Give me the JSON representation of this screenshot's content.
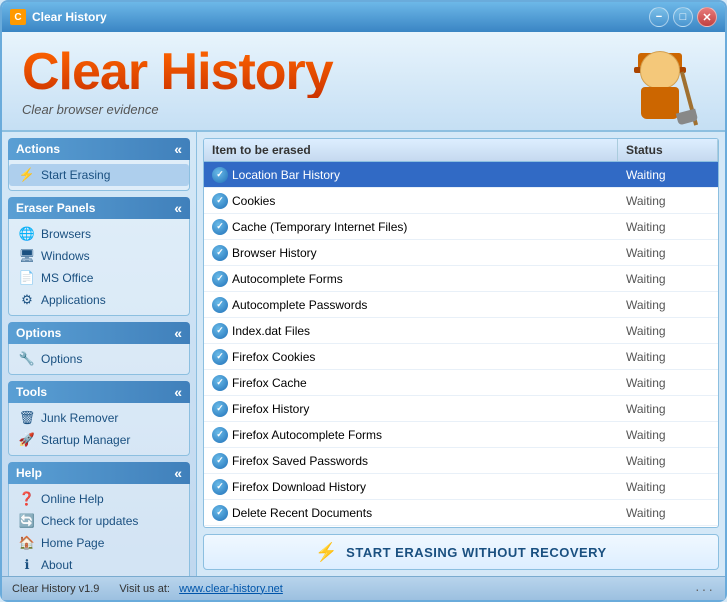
{
  "window": {
    "title": "Clear History",
    "controls": {
      "minimize": "−",
      "maximize": "□",
      "close": "✕"
    }
  },
  "header": {
    "logo_title": "Clear History",
    "logo_subtitle": "Clear browser evidence"
  },
  "sidebar": {
    "sections": [
      {
        "id": "actions",
        "label": "Actions",
        "items": [
          {
            "id": "start-erasing",
            "label": "Start Erasing",
            "icon": "⚡"
          }
        ]
      },
      {
        "id": "eraser-panels",
        "label": "Eraser Panels",
        "items": [
          {
            "id": "browsers",
            "label": "Browsers",
            "icon": "🌐"
          },
          {
            "id": "windows",
            "label": "Windows",
            "icon": "🖥"
          },
          {
            "id": "ms-office",
            "label": "MS Office",
            "icon": "📄"
          },
          {
            "id": "applications",
            "label": "Applications",
            "icon": "⚙"
          }
        ]
      },
      {
        "id": "options",
        "label": "Options",
        "items": [
          {
            "id": "options-item",
            "label": "Options",
            "icon": "🔧"
          }
        ]
      },
      {
        "id": "tools",
        "label": "Tools",
        "items": [
          {
            "id": "junk-remover",
            "label": "Junk Remover",
            "icon": "🗑"
          },
          {
            "id": "startup-manager",
            "label": "Startup Manager",
            "icon": "🚀"
          }
        ]
      },
      {
        "id": "help",
        "label": "Help",
        "items": [
          {
            "id": "online-help",
            "label": "Online Help",
            "icon": "❓"
          },
          {
            "id": "check-updates",
            "label": "Check for updates",
            "icon": "🔄"
          },
          {
            "id": "home-page",
            "label": "Home Page",
            "icon": "🏠"
          },
          {
            "id": "about",
            "label": "About",
            "icon": "ℹ"
          }
        ]
      }
    ]
  },
  "table": {
    "columns": [
      {
        "id": "item",
        "label": "Item to be erased"
      },
      {
        "id": "status",
        "label": "Status"
      }
    ],
    "rows": [
      {
        "id": 1,
        "item": "Location Bar History",
        "status": "Waiting",
        "selected": true
      },
      {
        "id": 2,
        "item": "Cookies",
        "status": "Waiting",
        "selected": false
      },
      {
        "id": 3,
        "item": "Cache (Temporary Internet Files)",
        "status": "Waiting",
        "selected": false
      },
      {
        "id": 4,
        "item": "Browser History",
        "status": "Waiting",
        "selected": false
      },
      {
        "id": 5,
        "item": "Autocomplete Forms",
        "status": "Waiting",
        "selected": false
      },
      {
        "id": 6,
        "item": "Autocomplete Passwords",
        "status": "Waiting",
        "selected": false
      },
      {
        "id": 7,
        "item": "Index.dat Files",
        "status": "Waiting",
        "selected": false
      },
      {
        "id": 8,
        "item": "Firefox Cookies",
        "status": "Waiting",
        "selected": false
      },
      {
        "id": 9,
        "item": "Firefox Cache",
        "status": "Waiting",
        "selected": false
      },
      {
        "id": 10,
        "item": "Firefox History",
        "status": "Waiting",
        "selected": false
      },
      {
        "id": 11,
        "item": "Firefox Autocomplete Forms",
        "status": "Waiting",
        "selected": false
      },
      {
        "id": 12,
        "item": "Firefox Saved Passwords",
        "status": "Waiting",
        "selected": false
      },
      {
        "id": 13,
        "item": "Firefox Download History",
        "status": "Waiting",
        "selected": false
      },
      {
        "id": 14,
        "item": "Delete Recent Documents",
        "status": "Waiting",
        "selected": false
      }
    ]
  },
  "erase_button": {
    "label": "START ERASING WITHOUT RECOVERY"
  },
  "status_bar": {
    "version": "Clear History v1.9",
    "visit_label": "Visit us at:",
    "website": "www.clear-history.net"
  }
}
